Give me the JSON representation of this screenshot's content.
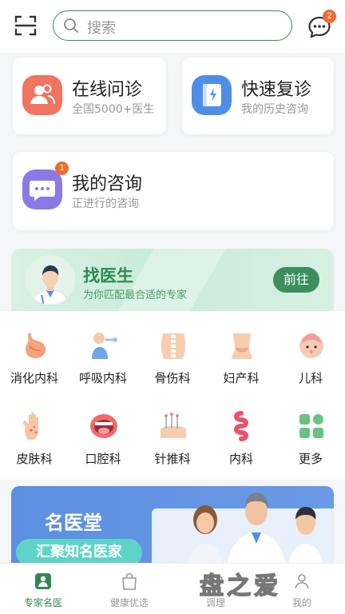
{
  "header": {
    "search_placeholder": "搜索",
    "message_badge": "2"
  },
  "quick": {
    "online": {
      "title": "在线问诊",
      "subtitle": "全国5000+医生"
    },
    "revisit": {
      "title": "快速复诊",
      "subtitle": "我的历史咨询"
    },
    "consult": {
      "title": "我的咨询",
      "subtitle": "正进行的咨询",
      "badge": "1"
    }
  },
  "find_doctor": {
    "title": "找医生",
    "subtitle": "为你匹配最合适的专家",
    "button": "前往"
  },
  "departments": [
    {
      "label": "消化内科",
      "icon": "stomach-icon"
    },
    {
      "label": "呼吸内科",
      "icon": "lungs-icon"
    },
    {
      "label": "骨伤科",
      "icon": "spine-icon"
    },
    {
      "label": "妇产科",
      "icon": "pelvis-icon"
    },
    {
      "label": "儿科",
      "icon": "baby-icon"
    },
    {
      "label": "皮肤科",
      "icon": "skin-hand-icon"
    },
    {
      "label": "口腔科",
      "icon": "mouth-icon"
    },
    {
      "label": "针推科",
      "icon": "acupuncture-icon"
    },
    {
      "label": "内科",
      "icon": "intestine-icon"
    },
    {
      "label": "更多",
      "icon": "grid-icon"
    }
  ],
  "banner": {
    "title": "名医堂",
    "subtitle": "汇聚知名医家"
  },
  "tabs": [
    {
      "label": "专家名医",
      "icon": "doctor-icon"
    },
    {
      "label": "健康优选",
      "icon": "bag-icon"
    },
    {
      "label": "调理",
      "icon": "care-icon"
    },
    {
      "label": "我的",
      "icon": "user-icon"
    }
  ],
  "watermark": "盘之爱",
  "colors": {
    "accent": "#3b8f5e",
    "badge": "#f06b2f",
    "banner_blue": "#5b8fe0"
  }
}
